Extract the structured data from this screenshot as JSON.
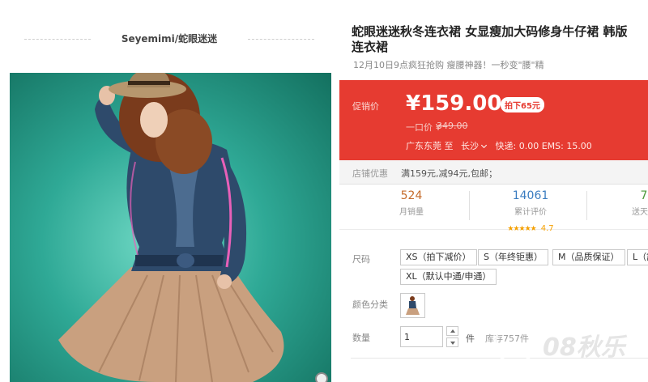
{
  "shop": {
    "name": "Seyemimi/蛇眼迷迷"
  },
  "product": {
    "title_line1": "蛇眼迷迷秋冬连衣裙 女显瘦加大码修身牛仔裙 韩版",
    "title_line2": "连衣裙",
    "subtitle": "12月10日9点疯狂抢购 瘦腰神器！一秒变\"腰\"精"
  },
  "promo": {
    "label": "促销价",
    "price": "¥159.00",
    "badge": "拍下65元",
    "orig_label": "一口价 ¥",
    "orig_value": "349.00",
    "ship_from": "广东东莞 至",
    "ship_city": "长沙",
    "ship_cost": "快递: 0.00 EMS: 15.00",
    "bg_color": "#e63b31"
  },
  "shop_discount": {
    "label": "店铺优惠",
    "value": "满159元,减94元,包邮；"
  },
  "stats": {
    "monthly_sales": {
      "value": "524",
      "label": "月销量"
    },
    "reviews": {
      "value": "14061",
      "label": "累计评价",
      "stars": "★★★★★",
      "rating": "4.7"
    },
    "points": {
      "value": "7",
      "label": "送天猫"
    }
  },
  "options": {
    "size_label": "尺码",
    "sizes": [
      "XS（拍下减价）",
      "S（年终钜惠）",
      "M（品质保证）",
      "L（舒",
      "XL（默认中通/申通）"
    ],
    "color_label": "颜色分类",
    "quantity_label": "数量",
    "quantity_value": "1",
    "unit": "件",
    "stock": "库存757件"
  },
  "watermark": {
    "text": "08秋乐"
  }
}
